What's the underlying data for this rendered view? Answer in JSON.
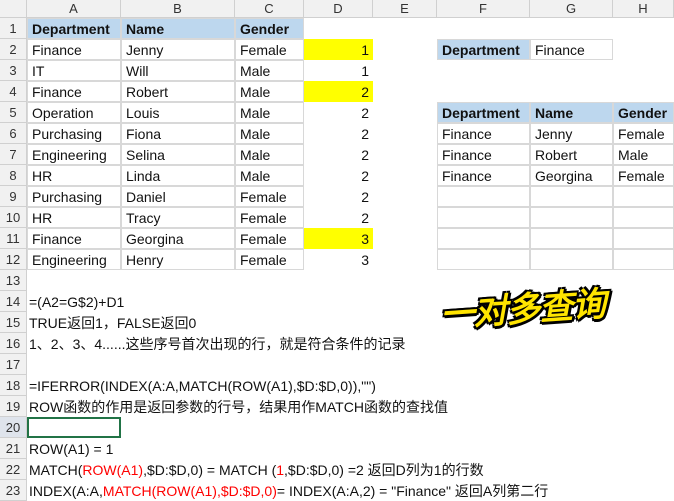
{
  "columns": [
    "A",
    "B",
    "C",
    "D",
    "E",
    "F",
    "G",
    "H"
  ],
  "rows": [
    "1",
    "2",
    "3",
    "4",
    "5",
    "6",
    "7",
    "8",
    "9",
    "10",
    "11",
    "12",
    "13",
    "14",
    "15",
    "16",
    "17",
    "18",
    "19",
    "20",
    "21",
    "22",
    "23"
  ],
  "main_table": {
    "headers": [
      "Department",
      "Name",
      "Gender"
    ],
    "rows": [
      [
        "Finance",
        "Jenny",
        "Female"
      ],
      [
        "IT",
        "Will",
        "Male"
      ],
      [
        "Finance",
        "Robert",
        "Male"
      ],
      [
        "Operation",
        "Louis",
        "Male"
      ],
      [
        "Purchasing",
        "Fiona",
        "Male"
      ],
      [
        "Engineering",
        "Selina",
        "Male"
      ],
      [
        "HR",
        "Linda",
        "Male"
      ],
      [
        "Purchasing",
        "Daniel",
        "Female"
      ],
      [
        "HR",
        "Tracy",
        "Female"
      ],
      [
        "Finance",
        "Georgina",
        "Female"
      ],
      [
        "Engineering",
        "Henry",
        "Female"
      ]
    ]
  },
  "helper_column": [
    "1",
    "1",
    "2",
    "2",
    "2",
    "2",
    "2",
    "2",
    "2",
    "3",
    "3"
  ],
  "helper_highlight": [
    true,
    false,
    true,
    false,
    false,
    false,
    false,
    false,
    false,
    true,
    false
  ],
  "lookup": {
    "label": "Department",
    "value": "Finance"
  },
  "result_table": {
    "headers": [
      "Department",
      "Name",
      "Gender"
    ],
    "rows": [
      [
        "Finance",
        "Jenny",
        "Female"
      ],
      [
        "Finance",
        "Robert",
        "Male"
      ],
      [
        "Finance",
        "Georgina",
        "Female"
      ],
      [
        "",
        "",
        ""
      ],
      [
        "",
        "",
        ""
      ],
      [
        "",
        "",
        ""
      ],
      [
        "",
        "",
        ""
      ]
    ]
  },
  "notes": {
    "r14": "=(A2=G$2)+D1",
    "r15": "TRUE返回1，FALSE返回0",
    "r16": "1、2、3、4......这些序号首次出现的行，就是符合条件的记录",
    "r18": "=IFERROR(INDEX(A:A,MATCH(ROW(A1),$D:$D,0)),\"\")",
    "r19": "ROW函数的作用是返回参数的行号，结果用作MATCH函数的查找值",
    "r21": "ROW(A1) = 1",
    "r22": {
      "p1": "MATCH(",
      "p2": "ROW(A1)",
      "p3": ",$D:$D,0) = MATCH (",
      "p4": "1",
      "p5": ",$D:$D,0) =2 返回D列为1的行数"
    },
    "r23": {
      "p1": "INDEX(A:A,",
      "p2": "MATCH(ROW(A1),$D:$D,0)",
      "p3": " = INDEX(A:A,2) = \"Finance\" 返回A列第二行"
    }
  },
  "callout": "一对多查询",
  "colors": {
    "header_fill": "#bdd7ee",
    "highlight": "#ffff00",
    "formula_blue": "#3399ff",
    "red": "#ff0000",
    "selection": "#217346"
  }
}
